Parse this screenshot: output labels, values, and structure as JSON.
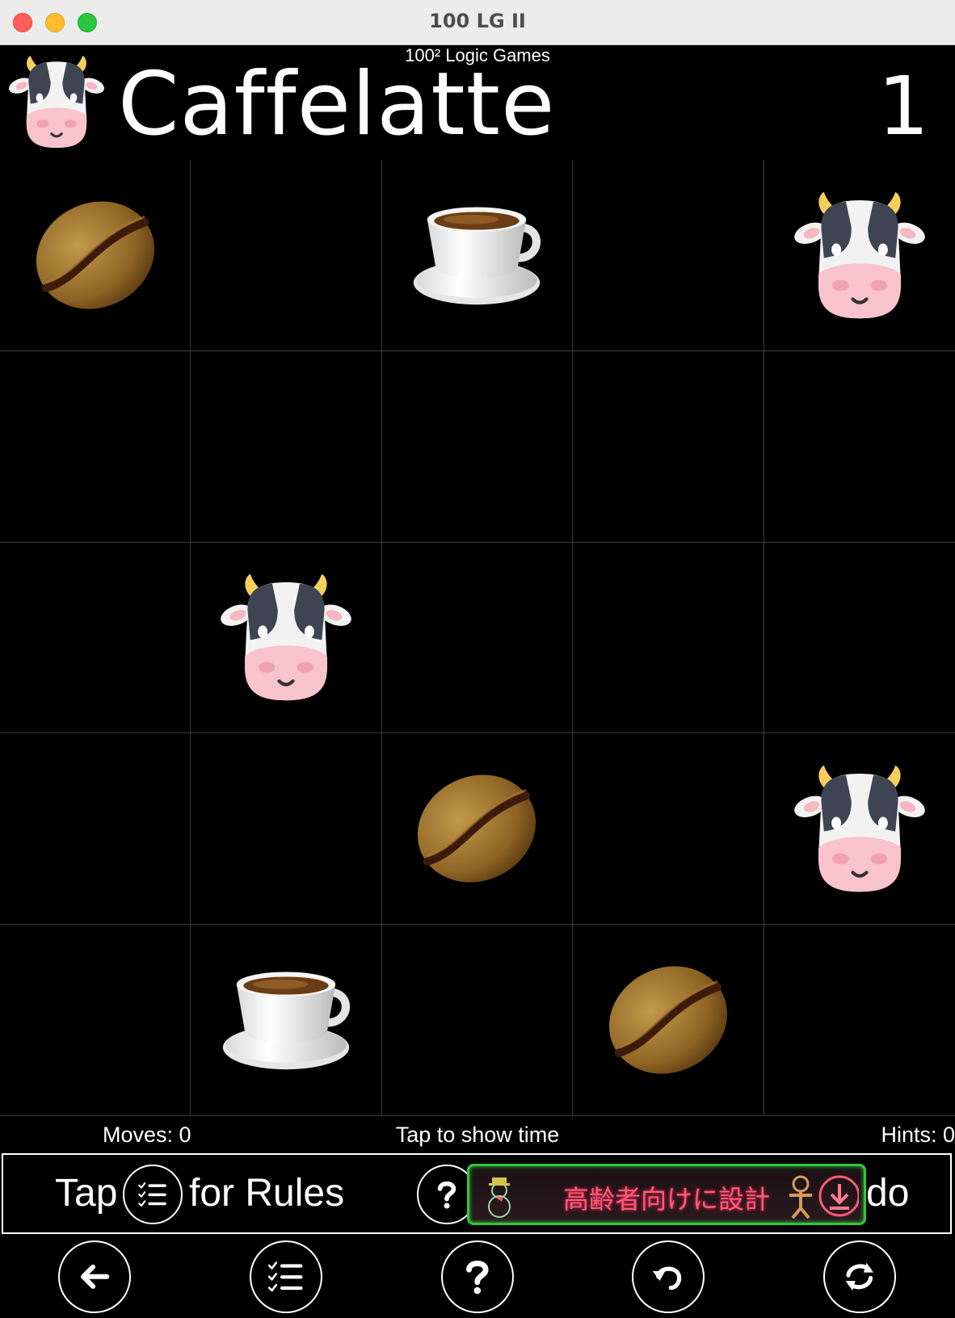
{
  "window": {
    "title": "100 LG II"
  },
  "header": {
    "subtitle": "100² Logic Games",
    "game_name": "Caffelatte",
    "level": "1",
    "logo_icon": "cow-face-icon"
  },
  "board": {
    "rows": 5,
    "cols": 5,
    "cells": [
      [
        "bean",
        "",
        "cup",
        "",
        "cow"
      ],
      [
        "",
        "",
        "",
        "",
        ""
      ],
      [
        "",
        "cow",
        "",
        "",
        ""
      ],
      [
        "",
        "",
        "bean",
        "",
        "cow"
      ],
      [
        "",
        "cup",
        "",
        "bean",
        ""
      ]
    ]
  },
  "status": {
    "moves": "Moves: 0",
    "timer": "Tap to show time",
    "hints": "Hints: 0"
  },
  "rules_bar": {
    "tap": "Tap",
    "for_rules": "for Rules",
    "trailing": "do"
  },
  "ad": {
    "text": "高齢者向けに設計"
  },
  "toolbar": {
    "buttons": [
      "back-arrow-icon",
      "rules-list-icon",
      "help-question-icon",
      "undo-icon",
      "restart-icon"
    ]
  },
  "colors": {
    "background": "#000000",
    "grid_line": "#3c3c3c",
    "text": "#ffffff",
    "ad_border": "#2ec83c",
    "ad_text": "#ff5a78"
  }
}
